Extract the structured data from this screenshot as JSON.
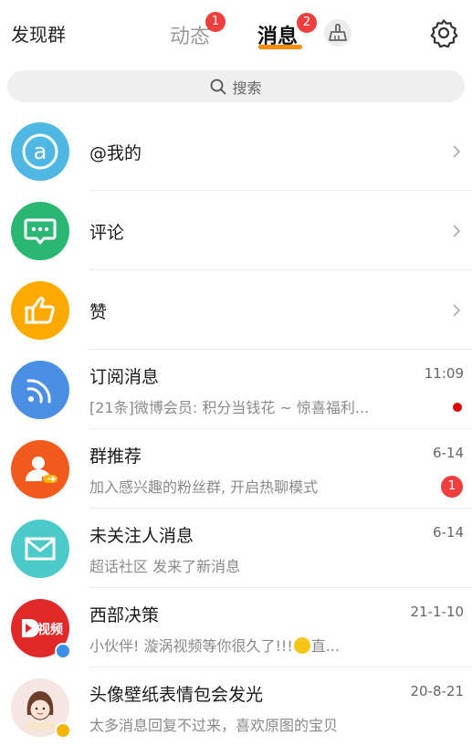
{
  "header": {
    "discover_label": "发现群",
    "tabs": [
      {
        "label": "动态",
        "badge": "1"
      },
      {
        "label": "消息",
        "badge": "2"
      }
    ],
    "broom_icon": "broom-icon",
    "settings_icon": "gear-icon"
  },
  "search": {
    "label": "搜索"
  },
  "list": [
    {
      "title": "@我的",
      "icon": "at-icon",
      "color": "#4fb7e3"
    },
    {
      "title": "评论",
      "icon": "comment-icon",
      "color": "#2bb673"
    },
    {
      "title": "赞",
      "icon": "thumb-up-icon",
      "color": "#ffaa00"
    },
    {
      "title": "订阅消息",
      "sub": "[21条]微博会员: 积分当钱花 ~ 惊喜福利...",
      "time": "11:09",
      "icon": "rss-icon",
      "color": "#4a8fe4"
    },
    {
      "title": "群推荐",
      "sub": "加入感兴趣的粉丝群, 开启热聊模式",
      "time": "6-14",
      "icon": "group-recommend-icon",
      "color": "#f25a1d",
      "badge": "1"
    },
    {
      "title": "未关注人消息",
      "sub": "超话社区 发来了新消息",
      "time": "6-14",
      "icon": "mail-icon",
      "color": "#4cc9c9"
    },
    {
      "title": "西部决策",
      "sub": "小伙伴! 漩涡视频等你很久了!!!",
      "sub_suffix": "直...",
      "time": "21-1-10",
      "avatar_text": "视频",
      "color": "#e12929"
    },
    {
      "title": "头像壁纸表情包会发光",
      "sub": "太多消息回复不过来，喜欢原图的宝贝",
      "time": "20-8-21",
      "color": "#f6e6e3"
    }
  ]
}
